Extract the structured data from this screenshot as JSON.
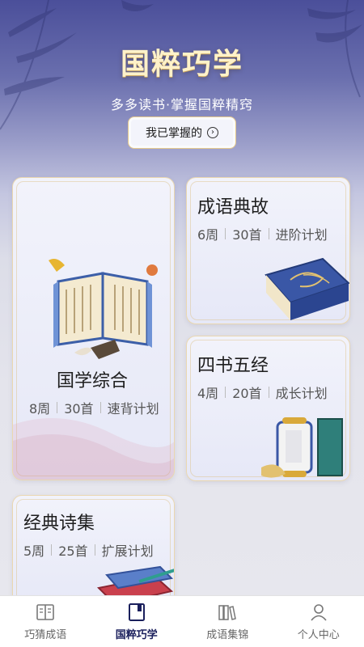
{
  "hero": {
    "title": "国粹巧学",
    "subtitle": "多多读书·掌握国粹精窍"
  },
  "mastered_button": {
    "label": "我已掌握的"
  },
  "cards": [
    {
      "title": "国学综合",
      "weeks": "8周",
      "count": "30首",
      "plan": "速背计划"
    },
    {
      "title": "成语典故",
      "weeks": "6周",
      "count": "30首",
      "plan": "进阶计划"
    },
    {
      "title": "四书五经",
      "weeks": "4周",
      "count": "20首",
      "plan": "成长计划"
    },
    {
      "title": "经典诗集",
      "weeks": "5周",
      "count": "25首",
      "plan": "扩展计划"
    }
  ],
  "tabs": [
    {
      "label": "巧猜成语",
      "icon": "book-open-icon",
      "active": false
    },
    {
      "label": "国粹巧学",
      "icon": "book-icon",
      "active": true
    },
    {
      "label": "成语集锦",
      "icon": "books-icon",
      "active": false
    },
    {
      "label": "个人中心",
      "icon": "user-icon",
      "active": false
    }
  ],
  "colors": {
    "header_bg": "#4b4f9a",
    "title_gold": "#fff2c9",
    "card_border": "#ead7b0",
    "active_tab": "#1a1f5c"
  }
}
